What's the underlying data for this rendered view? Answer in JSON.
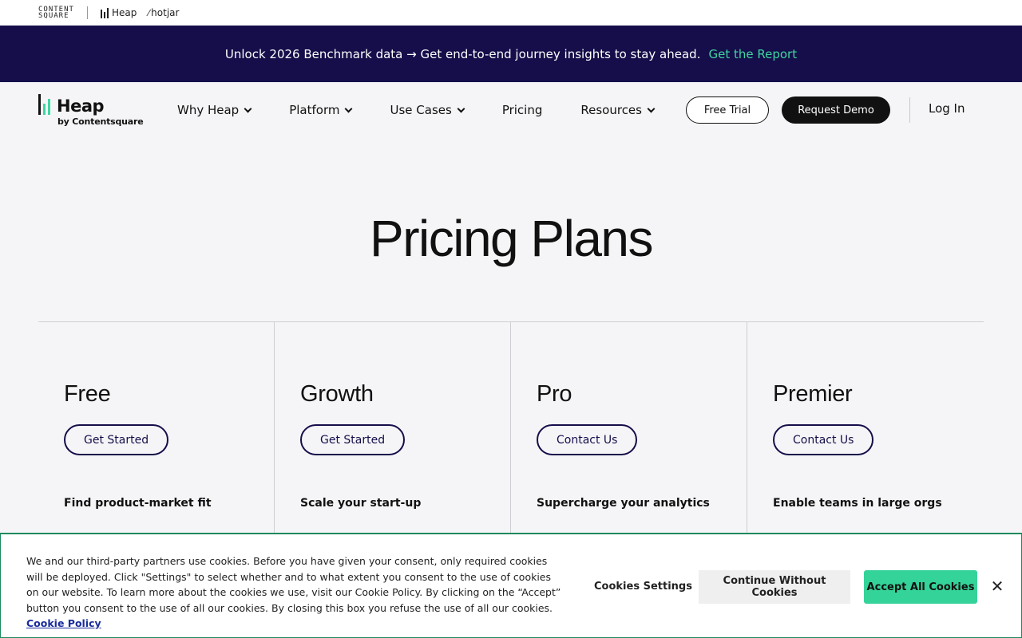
{
  "brandbar": {
    "contentsquare_line1": "CONTENT",
    "contentsquare_line2": "SQUARE",
    "heap_label": "Heap",
    "hotjar_label": "hotjar"
  },
  "announcement": {
    "text": "Unlock 2026 Benchmark data → Get end-to-end journey insights to stay ahead.",
    "link": "Get the Report"
  },
  "nav": {
    "logo_word": "Heap",
    "logo_sub": "by Contentsquare",
    "items": [
      {
        "label": "Why Heap",
        "dropdown": true
      },
      {
        "label": "Platform",
        "dropdown": true
      },
      {
        "label": "Use Cases",
        "dropdown": true
      },
      {
        "label": "Pricing",
        "dropdown": false
      },
      {
        "label": "Resources",
        "dropdown": true
      }
    ],
    "free_trial": "Free Trial",
    "request_demo": "Request Demo",
    "login": "Log In"
  },
  "hero": {
    "title": "Pricing Plans"
  },
  "plans": [
    {
      "name": "Free",
      "button": "Get Started",
      "tagline": "Find product-market fit"
    },
    {
      "name": "Growth",
      "button": "Get Started",
      "tagline": "Scale your start-up"
    },
    {
      "name": "Pro",
      "button": "Contact Us",
      "tagline": "Supercharge your analytics"
    },
    {
      "name": "Premier",
      "button": "Contact Us",
      "tagline": "Enable teams in large orgs"
    }
  ],
  "cookie": {
    "text": "We and our third-party partners use cookies. Before you have given your consent, only required cookies will be deployed. Click \"Settings\" to select whether and to what extent you consent to the use of cookies on our website. To learn more about the cookies we use, visit our Cookie Policy. By clicking on the “Accept” button you consent to the use of all our cookies. By closing this box you refuse the use of all our cookies.",
    "policy_link": "Cookie Policy",
    "settings": "Cookies Settings",
    "continue": "Continue Without Cookies",
    "accept": "Accept All Cookies",
    "close": "✕"
  },
  "colors": {
    "announce_bg": "#150e4a",
    "accent_green": "#3fd6a1",
    "accept_green": "#34d399",
    "page_bg": "#f5f5f7"
  }
}
